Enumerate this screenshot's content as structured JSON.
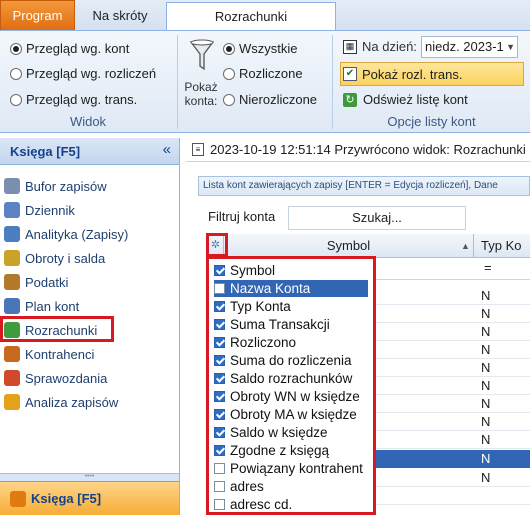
{
  "tabs": {
    "program": "Program",
    "na_skroty": "Na skróty",
    "rozrachunki": "Rozrachunki"
  },
  "widok": {
    "options": [
      {
        "label": "Przegląd wg. kont",
        "selected": true
      },
      {
        "label": "Przegląd wg. rozliczeń",
        "selected": false
      },
      {
        "label": "Przegląd wg. trans.",
        "selected": false
      }
    ],
    "group_label": "Widok"
  },
  "pokaz": {
    "label_line1": "Pokaż",
    "label_line2": "konta:",
    "options": [
      {
        "label": "Wszystkie",
        "selected": true
      },
      {
        "label": "Rozliczone",
        "selected": false
      },
      {
        "label": "Nierozliczone",
        "selected": false
      }
    ]
  },
  "opcje": {
    "na_dzien_label": "Na dzień:",
    "na_dzien_value": "niedz. 2023-1",
    "pokaz_rozl_trans": "Pokaż rozl. trans.",
    "odswiez": "Odśwież listę kont",
    "group_label": "Opcje listy kont"
  },
  "nav": {
    "header": "Księga [F5]",
    "collapse_glyph": "«",
    "items": [
      {
        "label": "Bufor zapisów",
        "icon": "bufor-icon",
        "color": "#7a8fb0"
      },
      {
        "label": "Dziennik",
        "icon": "dziennik-icon",
        "color": "#5b83c3"
      },
      {
        "label": "Analityka (Zapisy)",
        "icon": "analityka-icon",
        "color": "#4c7fc2"
      },
      {
        "label": "Obroty i salda",
        "icon": "obroty-icon",
        "color": "#c9a227"
      },
      {
        "label": "Podatki",
        "icon": "podatki-icon",
        "color": "#b37a2a"
      },
      {
        "label": "Plan kont",
        "icon": "plan-kont-icon",
        "color": "#4a76b8"
      },
      {
        "label": "Rozrachunki",
        "icon": "rozrachunki-icon",
        "color": "#3e9b3e"
      },
      {
        "label": "Kontrahenci",
        "icon": "kontrahenci-icon",
        "color": "#c76a1f"
      },
      {
        "label": "Sprawozdania",
        "icon": "sprawozdania-icon",
        "color": "#d1492b"
      },
      {
        "label": "Analiza zapisów",
        "icon": "analiza-icon",
        "color": "#e3a21a"
      }
    ],
    "footer": "Księga [F5]"
  },
  "status": {
    "text": "2023-10-19 12:51:14  Przywrócono widok: Rozrachunki"
  },
  "info_bar": "Lista kont zawierających zapisy [ENTER = Edycja rozliczeń], Dane",
  "filter": {
    "label": "Filtruj konta",
    "search_button": "Szukaj..."
  },
  "grid": {
    "corner_glyph": "✲",
    "columns": [
      "Symbol",
      "Typ Ko"
    ],
    "filter_eq": "=",
    "row_values": [
      "N",
      "N",
      "N",
      "N",
      "N",
      "N",
      "N",
      "N",
      "N",
      "N",
      "N"
    ]
  },
  "column_chooser": {
    "items": [
      {
        "label": "Symbol",
        "checked": true,
        "highlighted": false
      },
      {
        "label": "Nazwa Konta",
        "checked": false,
        "highlighted": true
      },
      {
        "label": "Typ Konta",
        "checked": true,
        "highlighted": false
      },
      {
        "label": "Suma Transakcji",
        "checked": true,
        "highlighted": false
      },
      {
        "label": "Rozliczono",
        "checked": true,
        "highlighted": false
      },
      {
        "label": "Suma do rozliczenia",
        "checked": true,
        "highlighted": false
      },
      {
        "label": "Saldo rozrachunków",
        "checked": true,
        "highlighted": false
      },
      {
        "label": "Obroty WN w księdze",
        "checked": true,
        "highlighted": false
      },
      {
        "label": "Obroty MA w księdze",
        "checked": true,
        "highlighted": false
      },
      {
        "label": "Saldo w księdze",
        "checked": true,
        "highlighted": false
      },
      {
        "label": "Zgodne z księgą",
        "checked": true,
        "highlighted": false
      },
      {
        "label": "Powiązany kontrahent",
        "checked": false,
        "highlighted": false
      },
      {
        "label": "adres",
        "checked": false,
        "highlighted": false
      },
      {
        "label": "adresc cd.",
        "checked": false,
        "highlighted": false
      }
    ]
  },
  "colors": {
    "accent_orange": "#e06d12",
    "selection_blue": "#3266b4",
    "annotation_red": "#d71920"
  }
}
